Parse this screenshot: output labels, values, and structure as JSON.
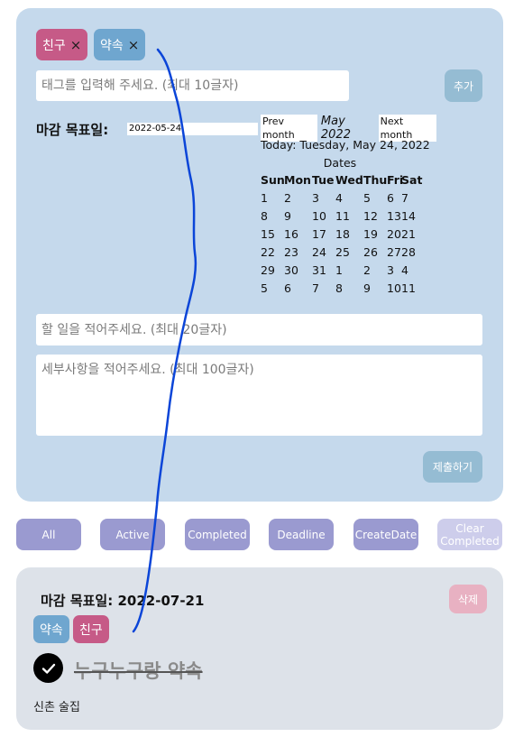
{
  "form": {
    "tags": [
      {
        "label": "친구",
        "remove": "×",
        "color": "#c65a87"
      },
      {
        "label": "약속",
        "remove": "×",
        "color": "#6fa6cf"
      }
    ],
    "tag_input_placeholder": "태그를 입력해 주세요. (최대 10글자)",
    "tag_add_label": "추가",
    "deadline_label": "마감 목표일:",
    "deadline_value": "2022-05-24",
    "todo_input_placeholder": "할 일을 적어주세요. (최대 20글자)",
    "detail_input_placeholder": "세부사항을 적어주세요. (최대 100글자)",
    "submit_label": "제출하기"
  },
  "calendar": {
    "prev_label": "Prev month",
    "month_label": "May 2022",
    "next_label": "Next month",
    "today_label": "Today: Tuesday, May 24, 2022",
    "dates_label": "Dates",
    "weekdays": [
      "Sun",
      "Mon",
      "Tue",
      "Wed",
      "Thu",
      "Fri",
      "Sat"
    ],
    "weeks": [
      [
        "1",
        "2",
        "3",
        "4",
        "5",
        "6",
        "7"
      ],
      [
        "8",
        "9",
        "10",
        "11",
        "12",
        "13",
        "14"
      ],
      [
        "15",
        "16",
        "17",
        "18",
        "19",
        "20",
        "21"
      ],
      [
        "22",
        "23",
        "24",
        "25",
        "26",
        "27",
        "28"
      ],
      [
        "29",
        "30",
        "31",
        "1",
        "2",
        "3",
        "4"
      ],
      [
        "5",
        "6",
        "7",
        "8",
        "9",
        "10",
        "11"
      ]
    ]
  },
  "filters": [
    {
      "label": "All",
      "enabled": true
    },
    {
      "label": "Active",
      "enabled": true
    },
    {
      "label": "Completed",
      "enabled": true
    },
    {
      "label": "Deadline",
      "enabled": true
    },
    {
      "label": "CreateDate",
      "enabled": true
    },
    {
      "label": "Clear Completed",
      "enabled": false
    }
  ],
  "todo": {
    "deadline_label": "마감 목표일:",
    "deadline_value": "2022-07-21",
    "delete_label": "삭제",
    "tags": [
      {
        "label": "약속",
        "color": "#6fa6cf"
      },
      {
        "label": "친구",
        "color": "#c65a87"
      }
    ],
    "completed": true,
    "title": "누구누구랑 약속",
    "detail": "신촌 술집"
  },
  "colors": {
    "form_card_bg": "#c5d9ec",
    "todo_card_bg": "#dde2e9",
    "filter_btn": "#9a9ad0",
    "annotation_stroke": "#0b45d8"
  }
}
